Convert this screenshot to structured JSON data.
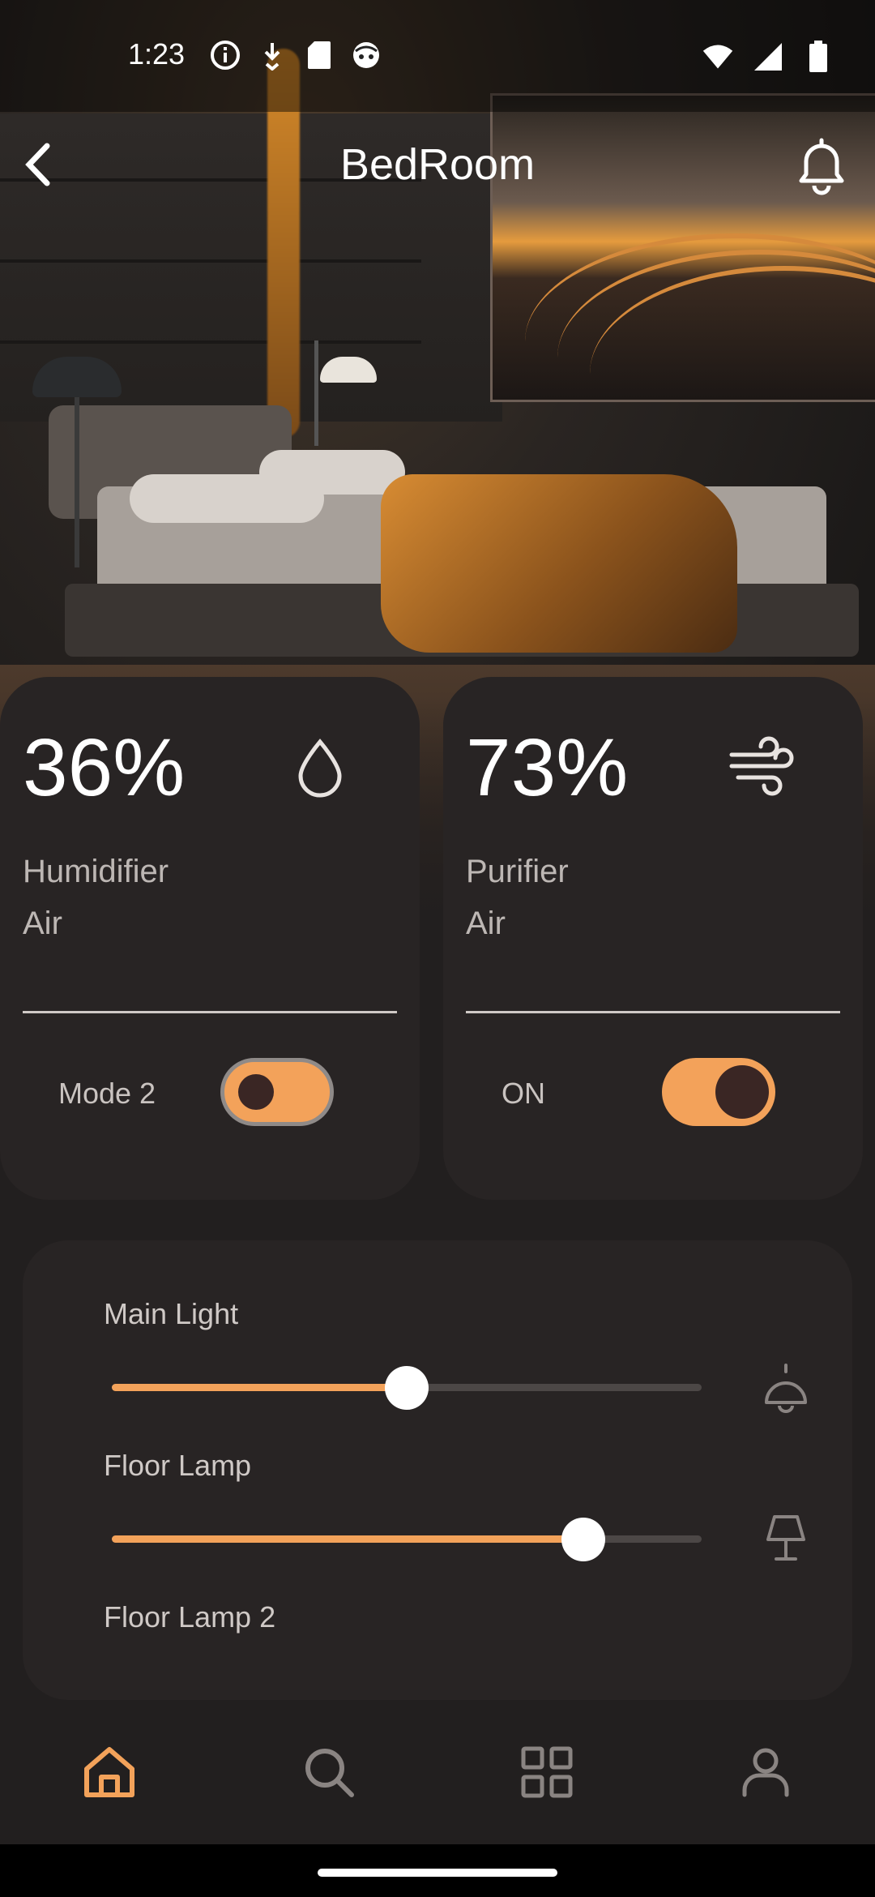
{
  "status_bar": {
    "time": "1:23",
    "left_icons": [
      "info-icon",
      "download-icon",
      "sd-card-icon",
      "face-icon"
    ],
    "right_icons": [
      "wifi-icon",
      "signal-icon",
      "battery-icon"
    ]
  },
  "header": {
    "title": "BedRoom",
    "back_icon": "chevron-left-icon",
    "notification_icon": "bell-icon"
  },
  "cards": [
    {
      "value": "36%",
      "icon": "droplet-icon",
      "label_line1": "Humidifier",
      "label_line2": "Air",
      "mode_label": "Mode 2",
      "toggle_on": true,
      "toggle_style": "outlined"
    },
    {
      "value": "73%",
      "icon": "wind-icon",
      "label_line1": "Purifier",
      "label_line2": "Air",
      "mode_label": "ON",
      "toggle_on": true,
      "toggle_style": "filled"
    }
  ],
  "lights": [
    {
      "label": "Main Light",
      "level": 0.5,
      "icon": "ceiling-lamp-icon"
    },
    {
      "label": "Floor Lamp",
      "level": 0.8,
      "icon": "table-lamp-icon"
    },
    {
      "label": "Floor Lamp 2"
    }
  ],
  "bottom_nav": {
    "items": [
      "home-icon",
      "search-icon",
      "grid-icon",
      "profile-icon"
    ],
    "active_index": 0
  },
  "colors": {
    "accent": "#f3a25a",
    "background": "#221f1f",
    "card": "#282424",
    "text_secondary": "#bdb7b4"
  }
}
